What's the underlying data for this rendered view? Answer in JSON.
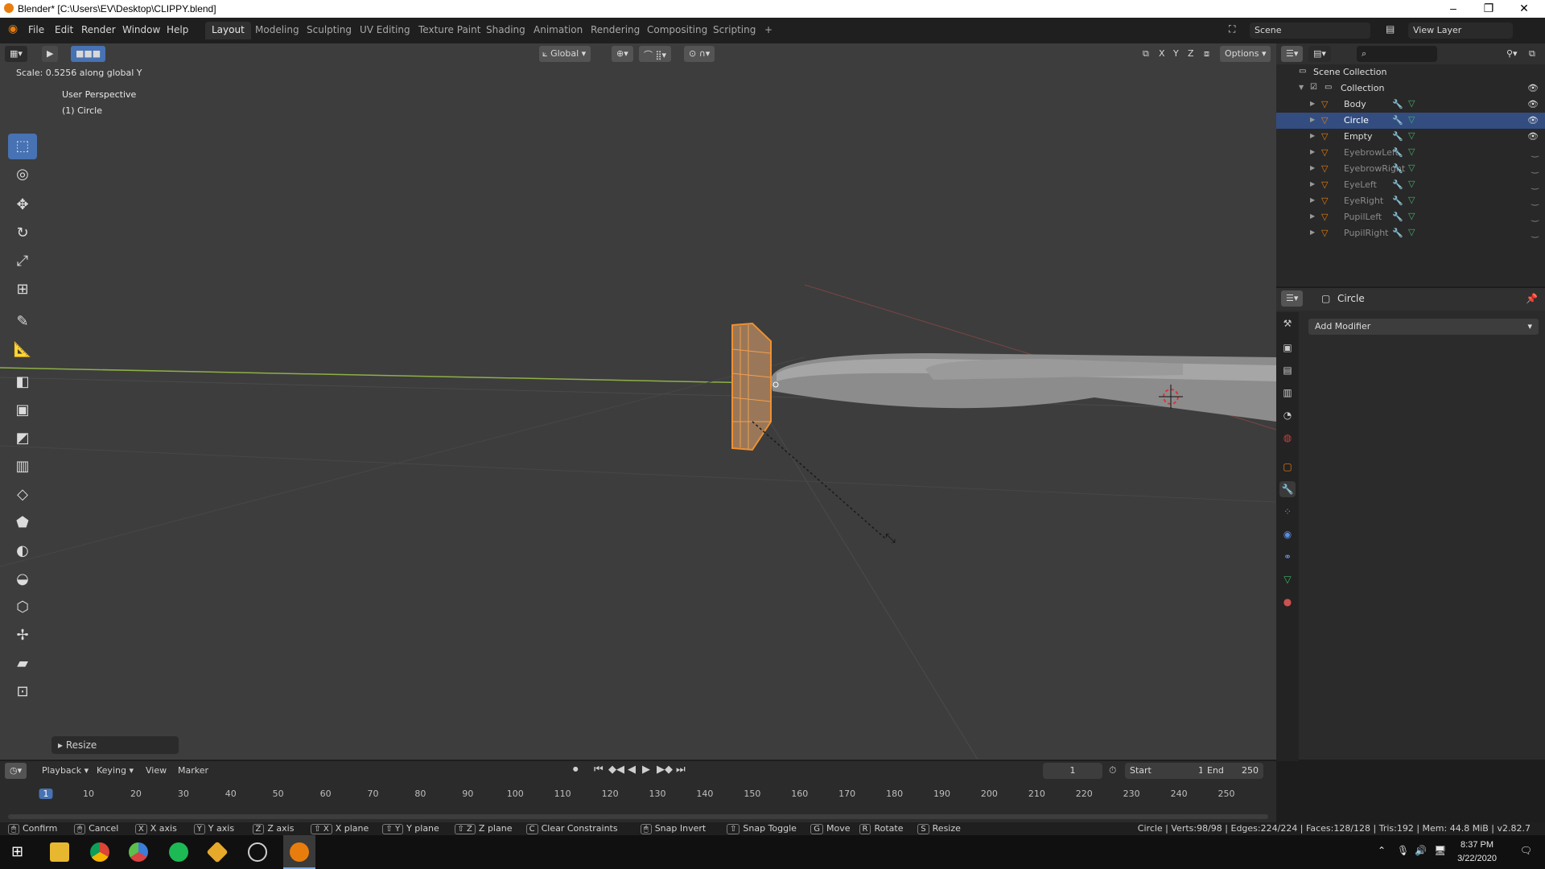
{
  "window": {
    "title": "Blender* [C:\\Users\\EV\\Desktop\\CLIPPY.blend]",
    "minimize": "–",
    "maximize": "❐",
    "close": "✕"
  },
  "menubar": {
    "menus": [
      "File",
      "Edit",
      "Render",
      "Window",
      "Help"
    ],
    "workspaces": [
      "Layout",
      "Modeling",
      "Sculpting",
      "UV Editing",
      "Texture Paint",
      "Shading",
      "Animation",
      "Rendering",
      "Compositing",
      "Scripting"
    ],
    "add_workspace": "+",
    "scene_label": "Scene",
    "view_layer_label": "View Layer"
  },
  "viewport": {
    "operation_text": "Scale: 0.5256 along global Y",
    "view_name": "User Perspective",
    "active_object": "(1) Circle",
    "transform_orientation": "Global",
    "axes": [
      "X",
      "Y",
      "Z"
    ],
    "options_label": "Options",
    "last_op_panel": "Resize"
  },
  "outliner": {
    "root": "Scene Collection",
    "collection": "Collection",
    "items": [
      {
        "name": "Body",
        "visible": true,
        "selected": false
      },
      {
        "name": "Circle",
        "visible": true,
        "selected": true
      },
      {
        "name": "Empty",
        "visible": true,
        "selected": false
      },
      {
        "name": "EyebrowLeft",
        "visible": false,
        "selected": false
      },
      {
        "name": "EyebrowRight",
        "visible": false,
        "selected": false
      },
      {
        "name": "EyeLeft",
        "visible": false,
        "selected": false
      },
      {
        "name": "EyeRight",
        "visible": false,
        "selected": false
      },
      {
        "name": "PupilLeft",
        "visible": false,
        "selected": false
      },
      {
        "name": "PupilRight",
        "visible": false,
        "selected": false
      }
    ]
  },
  "properties": {
    "object_name": "Circle",
    "add_modifier": "Add Modifier"
  },
  "timeline": {
    "menus": [
      "Playback",
      "Keying",
      "View",
      "Marker"
    ],
    "current_frame": "1",
    "start_label": "Start",
    "start": "1",
    "end_label": "End",
    "end": "250",
    "ticks": [
      "1",
      "10",
      "20",
      "30",
      "40",
      "50",
      "60",
      "70",
      "80",
      "90",
      "100",
      "110",
      "120",
      "130",
      "140",
      "150",
      "160",
      "170",
      "180",
      "190",
      "200",
      "210",
      "220",
      "230",
      "240",
      "250"
    ]
  },
  "statusbar": {
    "hints": [
      {
        "key": "",
        "label": "Confirm"
      },
      {
        "key": "",
        "label": "Cancel"
      },
      {
        "key": "X",
        "label": "X axis"
      },
      {
        "key": "Y",
        "label": "Y axis"
      },
      {
        "key": "Z",
        "label": "Z axis"
      },
      {
        "key": "⇧ X",
        "label": "X plane"
      },
      {
        "key": "⇧ Y",
        "label": "Y plane"
      },
      {
        "key": "⇧ Z",
        "label": "Z plane"
      },
      {
        "key": "C",
        "label": "Clear Constraints"
      },
      {
        "key": "",
        "label": "Snap Invert"
      },
      {
        "key": "⇧",
        "label": "Snap Toggle"
      },
      {
        "key": "G",
        "label": "Move"
      },
      {
        "key": "R",
        "label": "Rotate"
      },
      {
        "key": "S",
        "label": "Resize"
      }
    ],
    "stats": "Circle | Verts:98/98 | Edges:224/224 | Faces:128/128 | Tris:192 | Mem: 44.8 MiB | v2.82.7"
  },
  "taskbar": {
    "time": "8:37 PM",
    "date": "3/22/2020"
  },
  "colors": {
    "accent": "#4772b3",
    "selection_orange": "#e87d0d",
    "viewport_bg": "#3d3d3d"
  }
}
